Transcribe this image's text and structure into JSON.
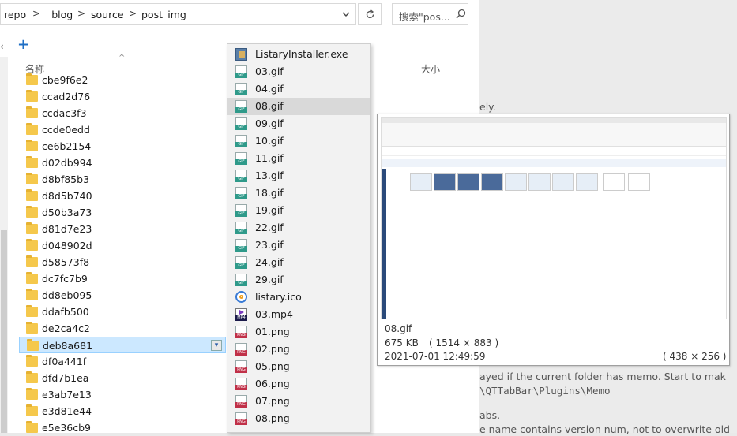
{
  "address_bar": {
    "breadcrumbs": [
      "repo",
      "_blog",
      "source",
      "post_img"
    ],
    "separator": ">",
    "search_placeholder": "搜索\"pos..."
  },
  "toolbar": {
    "new_label": "+"
  },
  "columns": {
    "name": "名称",
    "size": "大小"
  },
  "folders": [
    "cbe9f6e2",
    "ccad2d76",
    "ccdac3f3",
    "ccde0edd",
    "ce6b2154",
    "d02db994",
    "d8bf85b3",
    "d8d5b740",
    "d50b3a73",
    "d81d7e23",
    "d048902d",
    "d58573f8",
    "dc7fc7b9",
    "dd8eb095",
    "ddafb500",
    "de2ca4c2",
    "deb8a681",
    "df0a441f",
    "dfd7b1ea",
    "e3ab7e13",
    "e3d81e44",
    "e5e36cb9"
  ],
  "selected_folder": "deb8a681",
  "menu": {
    "items": [
      {
        "label": "ListaryInstaller.exe",
        "type": "exe"
      },
      {
        "label": "03.gif",
        "type": "gif"
      },
      {
        "label": "04.gif",
        "type": "gif"
      },
      {
        "label": "08.gif",
        "type": "gif",
        "hover": true
      },
      {
        "label": "09.gif",
        "type": "gif"
      },
      {
        "label": "10.gif",
        "type": "gif"
      },
      {
        "label": "11.gif",
        "type": "gif"
      },
      {
        "label": "13.gif",
        "type": "gif"
      },
      {
        "label": "18.gif",
        "type": "gif"
      },
      {
        "label": "19.gif",
        "type": "gif"
      },
      {
        "label": "22.gif",
        "type": "gif"
      },
      {
        "label": "23.gif",
        "type": "gif"
      },
      {
        "label": "24.gif",
        "type": "gif"
      },
      {
        "label": "29.gif",
        "type": "gif"
      },
      {
        "label": "listary.ico",
        "type": "ico"
      },
      {
        "label": "03.mp4",
        "type": "mp4"
      },
      {
        "label": "01.png",
        "type": "png"
      },
      {
        "label": "02.png",
        "type": "png"
      },
      {
        "label": "05.png",
        "type": "png"
      },
      {
        "label": "06.png",
        "type": "png"
      },
      {
        "label": "07.png",
        "type": "png"
      },
      {
        "label": "08.png",
        "type": "png"
      }
    ]
  },
  "preview": {
    "filename": "08.gif",
    "filesize": "675 KB",
    "dimensions": "( 1514 × 883 )",
    "modified": "2021-07-01 12:49:59",
    "preview_size": "( 438 × 256 )"
  },
  "background_text": {
    "line1": "ely.",
    "line2": "ayed if the current folder has memo. Start to mak",
    "line3": "\\QTTabBar\\Plugins\\Memo",
    "line4": "abs.",
    "line5": "e name contains version num, not to overwrite old"
  },
  "colors": {
    "selection_bg": "#cce8ff",
    "menu_bg": "#f2f2f2",
    "menu_hover": "#d9d9d9",
    "folder": "#f5c84c",
    "accent": "#1f6fc5"
  }
}
